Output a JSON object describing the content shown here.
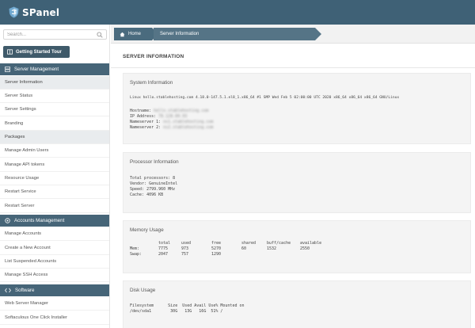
{
  "app": {
    "name": "SPanel"
  },
  "search": {
    "placeholder": "Search..."
  },
  "tour": {
    "label": "Getting Started Tour"
  },
  "sections": {
    "server": "Server Management",
    "accounts": "Accounts Management",
    "software": "Software"
  },
  "server_items": [
    "Server Information",
    "Server Status",
    "Server Settings",
    "Branding",
    "Packages",
    "Manage Admin Users",
    "Manage API tokens",
    "Resource Usage",
    "Restart Service",
    "Restart Server"
  ],
  "account_items": [
    "Manage Accounts",
    "Create a New Account",
    "List Suspended Accounts",
    "Manage SSH Access"
  ],
  "software_items": [
    "Web Server Manager",
    "Softaculous One Click Installer"
  ],
  "breadcrumb": {
    "home": "Home",
    "current": "Server Information"
  },
  "page": {
    "title": "SERVER INFORMATION"
  },
  "system": {
    "title": "System Information",
    "uname": "Linux hello.stablehosting.com 4.18.0-147.5.1.el8_1.x86_64 #1 SMP Wed Feb 5 02:00:00 UTC 2020 x86_64 x86_64 x86_64 GNU/Linux",
    "hostname_label": "Hostname:",
    "hostname_value": "hello.stablehosting.com",
    "ip_label": "IP Address:",
    "ip_value": "78.128.60.93",
    "ns1_label": "Nameserver 1:",
    "ns1_value": "ns1.stablehosting.com",
    "ns2_label": "Nameserver 2:",
    "ns2_value": "ns2.stablehosting.com"
  },
  "processor": {
    "title": "Processor Information",
    "lines": [
      "Total processors: 8",
      "Vendor: GenuineIntel",
      "Speed: 2799.960 MHz",
      "Cache: 4096 KB"
    ]
  },
  "memory": {
    "title": "Memory Usage",
    "headers": [
      "",
      "total",
      "used",
      "free",
      "shared",
      "buff/cache",
      "available"
    ],
    "rows": [
      [
        "Mem:",
        "7775",
        "973",
        "5270",
        "60",
        "1532",
        "2550"
      ],
      [
        "Swap:",
        "2047",
        "757",
        "1290",
        "",
        "",
        ""
      ]
    ]
  },
  "disk": {
    "title": "Disk Usage",
    "header": "Filesystem      Size  Used Avail Use% Mounted on",
    "row": "/dev/sda1        30G   13G   16G  51% /"
  }
}
